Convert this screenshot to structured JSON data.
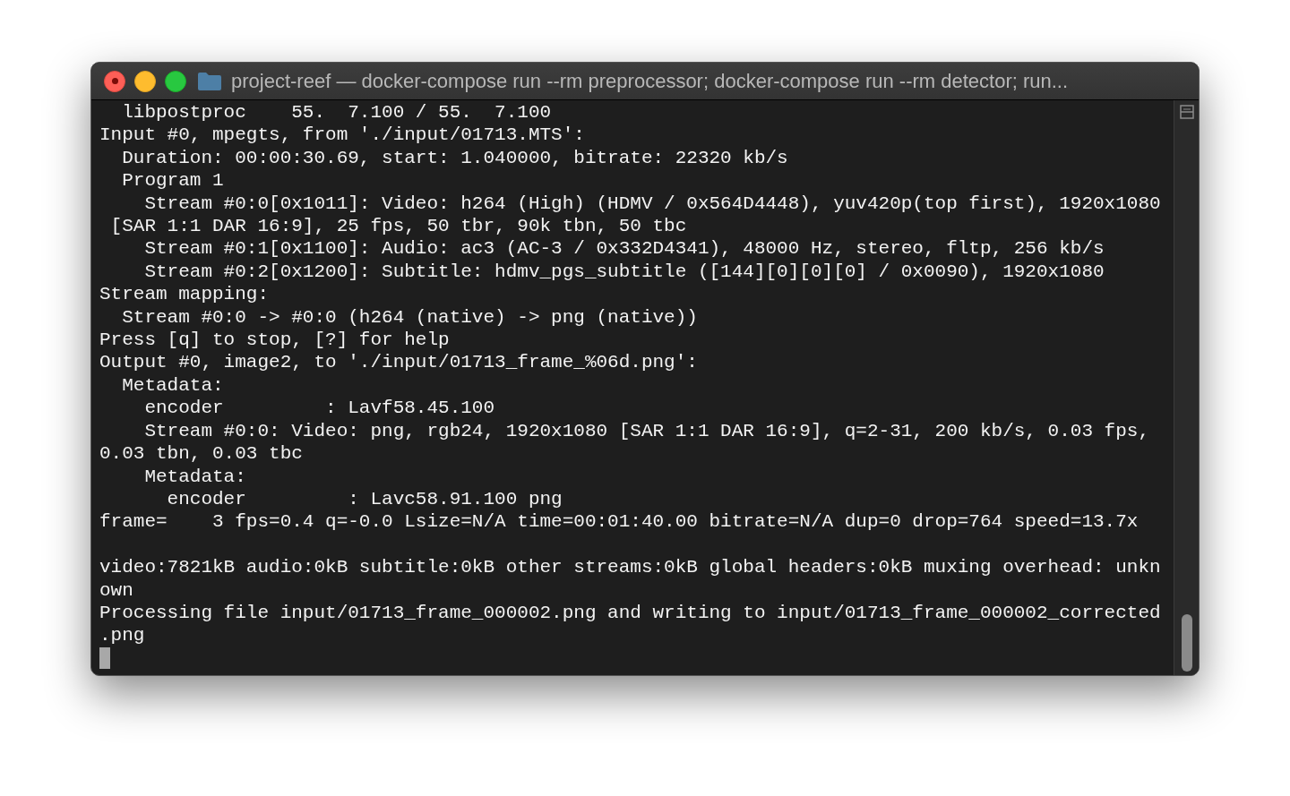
{
  "window": {
    "title": "project-reef — docker-compose run --rm preprocessor; docker-compose run --rm detector;  run..."
  },
  "terminal": {
    "blocks": [
      {
        "lines": [
          "  libpostproc    55.  7.100 / 55.  7.100",
          "Input #0, mpegts, from './input/01713.MTS':",
          "  Duration: 00:00:30.69, start: 1.040000, bitrate: 22320 kb/s",
          "  Program 1",
          "    Stream #0:0[0x1011]: Video: h264 (High) (HDMV / 0x564D4448), yuv420p(top first), 1920x1080",
          " [SAR 1:1 DAR 16:9], 25 fps, 50 tbr, 90k tbn, 50 tbc",
          "    Stream #0:1[0x1100]: Audio: ac3 (AC-3 / 0x332D4341), 48000 Hz, stereo, fltp, 256 kb/s",
          "    Stream #0:2[0x1200]: Subtitle: hdmv_pgs_subtitle ([144][0][0][0] / 0x0090), 1920x1080",
          "Stream mapping:",
          "  Stream #0:0 -> #0:0 (h264 (native) -> png (native))",
          "Press [q] to stop, [?] for help",
          "Output #0, image2, to './input/01713_frame_%06d.png':",
          "  Metadata:",
          "    encoder         : Lavf58.45.100",
          "    Stream #0:0: Video: png, rgb24, 1920x1080 [SAR 1:1 DAR 16:9], q=2-31, 200 kb/s, 0.03 fps,",
          "0.03 tbn, 0.03 tbc",
          "    Metadata:",
          "      encoder         : Lavc58.91.100 png",
          "frame=    3 fps=0.4 q=-0.0 Lsize=N/A time=00:01:40.00 bitrate=N/A dup=0 drop=764 speed=13.7x"
        ]
      },
      {
        "lines": [
          "video:7821kB audio:0kB subtitle:0kB other streams:0kB global headers:0kB muxing overhead: unkn",
          "own",
          "Processing file input/01713_frame_000002.png and writing to input/01713_frame_000002_corrected",
          ".png"
        ]
      }
    ]
  }
}
